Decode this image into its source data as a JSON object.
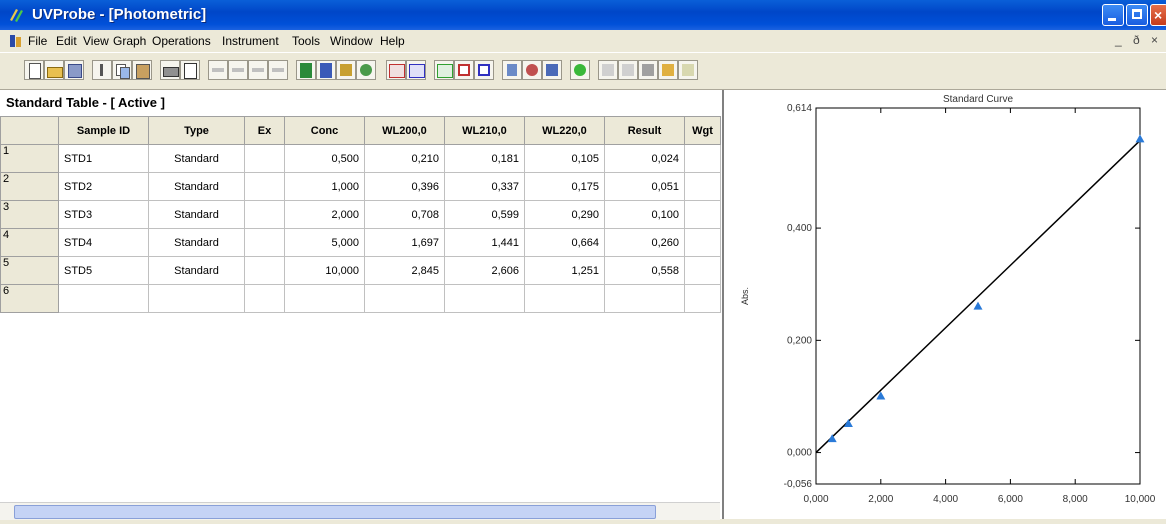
{
  "window": {
    "title": "UVProbe - [Photometric]"
  },
  "menu": [
    "File",
    "Edit",
    "View",
    "Graph",
    "Operations",
    "Instrument",
    "Tools",
    "Window",
    "Help"
  ],
  "mdi_controls": "_ ð ×",
  "standard_table": {
    "title": "Standard Table - [ Active ]",
    "columns": [
      "Sample ID",
      "Type",
      "Ex",
      "Conc",
      "WL200,0",
      "WL210,0",
      "WL220,0",
      "Result",
      "Wgt"
    ],
    "rows": [
      {
        "num": "1",
        "sample_id": "STD1",
        "type": "Standard",
        "ex": "",
        "conc": "0,500",
        "wl200": "0,210",
        "wl210": "0,181",
        "wl220": "0,105",
        "result": "0,024",
        "wgt": ""
      },
      {
        "num": "2",
        "sample_id": "STD2",
        "type": "Standard",
        "ex": "",
        "conc": "1,000",
        "wl200": "0,396",
        "wl210": "0,337",
        "wl220": "0,175",
        "result": "0,051",
        "wgt": ""
      },
      {
        "num": "3",
        "sample_id": "STD3",
        "type": "Standard",
        "ex": "",
        "conc": "2,000",
        "wl200": "0,708",
        "wl210": "0,599",
        "wl220": "0,290",
        "result": "0,100",
        "wgt": ""
      },
      {
        "num": "4",
        "sample_id": "STD4",
        "type": "Standard",
        "ex": "",
        "conc": "5,000",
        "wl200": "1,697",
        "wl210": "1,441",
        "wl220": "0,664",
        "result": "0,260",
        "wgt": ""
      },
      {
        "num": "5",
        "sample_id": "STD5",
        "type": "Standard",
        "ex": "",
        "conc": "10,000",
        "wl200": "2,845",
        "wl210": "2,606",
        "wl220": "1,251",
        "result": "0,558",
        "wgt": ""
      },
      {
        "num": "6",
        "sample_id": "",
        "type": "",
        "ex": "",
        "conc": "",
        "wl200": "",
        "wl210": "",
        "wl220": "",
        "result": "",
        "wgt": ""
      }
    ]
  },
  "chart_data": {
    "type": "scatter",
    "title": "Standard Curve",
    "ylabel": "Abs.",
    "x_ticks": [
      "0,000",
      "2,000",
      "4,000",
      "6,000",
      "8,000",
      "10,000"
    ],
    "y_ticks": [
      "0,614",
      "0,400",
      "0,200",
      "0,000",
      "-0,056"
    ],
    "xlim": [
      0,
      10
    ],
    "ylim": [
      -0.056,
      0.614
    ],
    "points": [
      {
        "x": 0.5,
        "y": 0.024
      },
      {
        "x": 1.0,
        "y": 0.051
      },
      {
        "x": 2.0,
        "y": 0.1
      },
      {
        "x": 5.0,
        "y": 0.26
      },
      {
        "x": 10.0,
        "y": 0.558
      }
    ],
    "fit_line": {
      "x0": 0,
      "y0": 0,
      "x1": 10,
      "y1": 0.556
    },
    "point_color": "#2a7ad8",
    "line_color": "#000000"
  }
}
